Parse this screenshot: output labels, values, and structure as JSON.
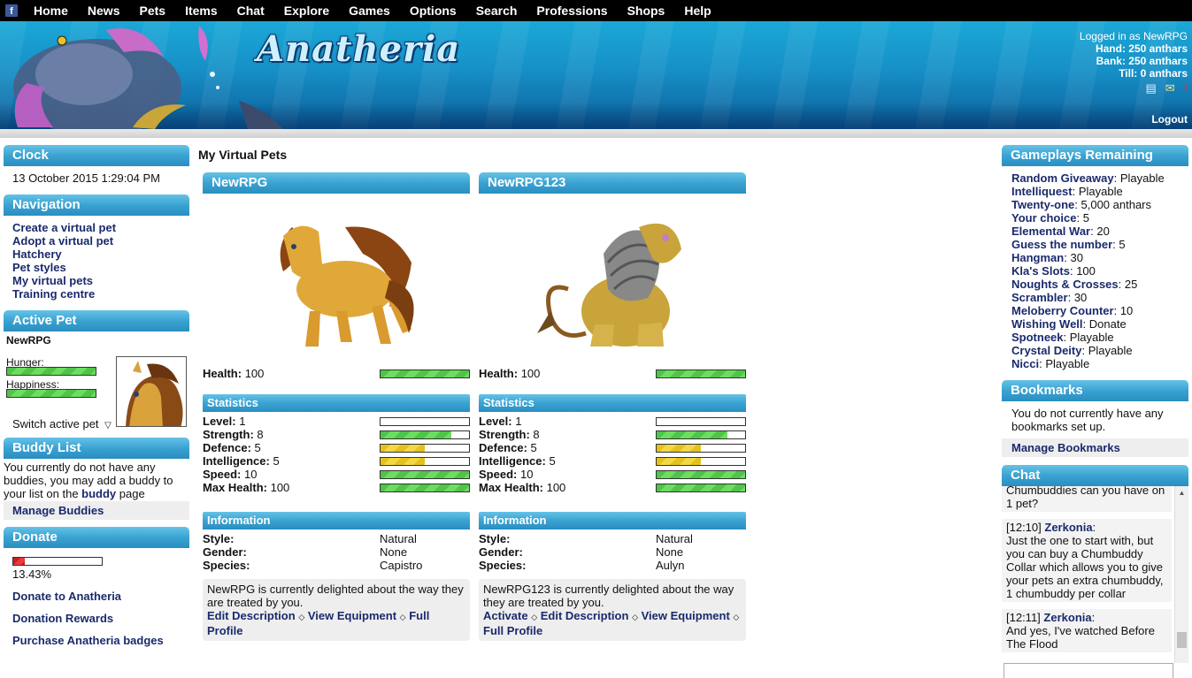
{
  "nav": [
    "Home",
    "News",
    "Pets",
    "Items",
    "Chat",
    "Explore",
    "Games",
    "Options",
    "Search",
    "Professions",
    "Shops",
    "Help"
  ],
  "banner": {
    "logo": "Anatheria",
    "logged_in": "Logged in as NewRPG",
    "hand": "Hand: 250 anthars",
    "bank": "Bank: 250 anthars",
    "till": "Till: 0 anthars",
    "logout": "Logout"
  },
  "clock": {
    "title": "Clock",
    "time": "13 October 2015 1:29:04 PM"
  },
  "navigation": {
    "title": "Navigation",
    "items": [
      "Create a virtual pet",
      "Adopt a virtual pet",
      "Hatchery",
      "Pet styles",
      "My virtual pets",
      "Training centre"
    ]
  },
  "active_pet": {
    "title": "Active Pet",
    "name": "NewRPG",
    "hunger_label": "Hunger:",
    "hunger": 1.0,
    "happiness_label": "Happiness:",
    "happiness": 1.0,
    "switch": "Switch active pet"
  },
  "buddy": {
    "title": "Buddy List",
    "text1": "You currently do not have any buddies, you may add a buddy to your list on the ",
    "link": "buddy",
    "text2": " page",
    "manage": "Manage Buddies"
  },
  "donate": {
    "title": "Donate",
    "percent": 13.43,
    "percent_label": "13.43%",
    "links": [
      "Donate to Anatheria",
      "Donation Rewards",
      "Purchase Anatheria badges"
    ]
  },
  "main_title": "My Virtual Pets",
  "pets": [
    {
      "name": "NewRPG",
      "health_label": "Health:",
      "health": "100",
      "health_frac": 1.0,
      "stats_title": "Statistics",
      "stats": [
        {
          "label": "Level:",
          "value": "1",
          "frac": 0.0,
          "color": "green"
        },
        {
          "label": "Strength:",
          "value": "8",
          "frac": 0.8,
          "color": "green"
        },
        {
          "label": "Defence:",
          "value": "5",
          "frac": 0.5,
          "color": "yellow"
        },
        {
          "label": "Intelligence:",
          "value": "5",
          "frac": 0.5,
          "color": "yellow"
        },
        {
          "label": "Speed:",
          "value": "10",
          "frac": 1.0,
          "color": "green"
        },
        {
          "label": "Max Health:",
          "value": "100",
          "frac": 1.0,
          "color": "green"
        }
      ],
      "info_title": "Information",
      "info": [
        {
          "label": "Style:",
          "value": "Natural"
        },
        {
          "label": "Gender:",
          "value": "None"
        },
        {
          "label": "Species:",
          "value": "Capistro"
        }
      ],
      "desc": "NewRPG is currently delighted about the way they are treated by you.",
      "links": [
        "Edit Description",
        "View Equipment",
        "Full Profile"
      ]
    },
    {
      "name": "NewRPG123",
      "health_label": "Health:",
      "health": "100",
      "health_frac": 1.0,
      "stats_title": "Statistics",
      "stats": [
        {
          "label": "Level:",
          "value": "1",
          "frac": 0.0,
          "color": "green"
        },
        {
          "label": "Strength:",
          "value": "8",
          "frac": 0.8,
          "color": "green"
        },
        {
          "label": "Defence:",
          "value": "5",
          "frac": 0.5,
          "color": "yellow"
        },
        {
          "label": "Intelligence:",
          "value": "5",
          "frac": 0.5,
          "color": "yellow"
        },
        {
          "label": "Speed:",
          "value": "10",
          "frac": 1.0,
          "color": "green"
        },
        {
          "label": "Max Health:",
          "value": "100",
          "frac": 1.0,
          "color": "green"
        }
      ],
      "info_title": "Information",
      "info": [
        {
          "label": "Style:",
          "value": "Natural"
        },
        {
          "label": "Gender:",
          "value": "None"
        },
        {
          "label": "Species:",
          "value": "Aulyn"
        }
      ],
      "desc": "NewRPG123 is currently delighted about the way they are treated by you.",
      "links": [
        "Activate",
        "Edit Description",
        "View Equipment",
        "Full Profile"
      ]
    }
  ],
  "gameplays": {
    "title": "Gameplays Remaining",
    "items": [
      {
        "name": "Random Giveaway",
        "value": "Playable"
      },
      {
        "name": "Intelliquest",
        "value": "Playable"
      },
      {
        "name": "Twenty-one",
        "value": "5,000 anthars"
      },
      {
        "name": "Your choice",
        "value": "5"
      },
      {
        "name": "Elemental War",
        "value": "20"
      },
      {
        "name": "Guess the number",
        "value": "5"
      },
      {
        "name": "Hangman",
        "value": "30"
      },
      {
        "name": "Kla's Slots",
        "value": "100"
      },
      {
        "name": "Noughts & Crosses",
        "value": "25"
      },
      {
        "name": "Scrambler",
        "value": "30"
      },
      {
        "name": "Meloberry Counter",
        "value": "10"
      },
      {
        "name": "Wishing Well",
        "value": "Donate"
      },
      {
        "name": "Spotneek",
        "value": "Playable"
      },
      {
        "name": "Crystal Deity",
        "value": "Playable"
      },
      {
        "name": "Nicci",
        "value": "Playable"
      }
    ]
  },
  "bookmarks": {
    "title": "Bookmarks",
    "text": "You do not currently have any bookmarks set up.",
    "manage": "Manage Bookmarks"
  },
  "chat": {
    "title": "Chat",
    "messages": [
      {
        "time": "",
        "user": "",
        "text": "Chumbuddies can you have on 1 pet?"
      },
      {
        "time": "[12:10]",
        "user": "Zerkonia",
        "text": "Just the one to start with, but you can buy a Chumbuddy Collar which allows you to give your pets an extra chumbuddy, 1 chumbuddy per collar"
      },
      {
        "time": "[12:11]",
        "user": "Zerkonia",
        "text": "And yes, I've watched Before The Flood"
      }
    ]
  }
}
